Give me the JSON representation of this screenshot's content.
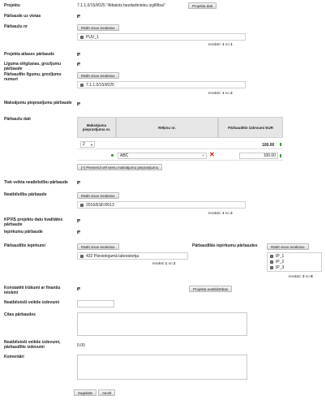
{
  "projekts": {
    "label": "Projekts",
    "value": "7.1.1.0/15/I/025 \"Atbalsts bezdarbnieku izglītībai\"",
    "button": "Projekta dati"
  },
  "parbaude_uz_vietas": {
    "label": "Pārbaude uz vietas"
  },
  "parbauzu_nr": {
    "label": "Pārbaužu nr",
    "button": "Rādīt visus ierakstus",
    "items": [
      "PUV_1"
    ],
    "count_prefix": "Ieraksti:",
    "count_from": "1",
    "count_sep": "no",
    "count_total": "1"
  },
  "projekta_atlases_parbaude": {
    "label": "Projekta atlases pārbaude"
  },
  "liguma_slegsanas": {
    "label": "Līguma slēgšanas, grozījumu pārbaude"
  },
  "parbaudito_ligumu": {
    "label": "Pārbaudīto līgumu, grozījumu numuri",
    "button": "Rādīt visus ierakstus",
    "items": [
      "7.1.1.0/15/I/025"
    ],
    "count_prefix": "Ieraksti:",
    "count_from": "1",
    "count_sep": "no",
    "count_total": "2"
  },
  "maksajumu_pieprasijumu": {
    "label": "Maksājumu pieprasījumu pārbaude"
  },
  "parbauzu_dati": {
    "label": "Pārbaužu dati",
    "col1": "Maksājumu pieprasījuma nr.",
    "col2": "Rēķinu nr.",
    "col3": "Pārbaudītie izdevumi EUR",
    "select_value": "2",
    "total": "100.00",
    "invoice": "ABC",
    "amount": "100.00",
    "add_button": "[+] Pievienot vēl vienu maksājumu pieprasījumu"
  },
  "tiek_veikta": {
    "label": "Tiek veikta neatbilstību pārbaude"
  },
  "neatbilstibu_parbaude": {
    "label": "Neatbilstību pārbaude",
    "button": "Rādīt visus ierakstus",
    "items": [
      "2016/ESF/0013"
    ],
    "count_prefix": "Ieraksti:",
    "count_from": "1",
    "count_sep": "no",
    "count_total": "2"
  },
  "kpvis": {
    "label": "KPVIS projektu datu kvalitātes pārbaude"
  },
  "iepirkumu_parbaude": {
    "label": "Iepirkumu pārbaude"
  },
  "parbauditie_iepirkumi": {
    "label": "Pārbaudītie iepirkumi",
    "button": "Rādīt visus ierakstus",
    "items": [
      "432 Pārvietojamā laboratorija"
    ],
    "count_prefix": "Ieraksti",
    "count_from": "1",
    "count_sep": "no",
    "count_total": "2"
  },
  "parbaudito_iepirkumu_parbaudes": {
    "label": "Pārbaudītās iepirkumu pārbaudes",
    "button": "Rādīt visus ierakstus",
    "items": [
      "IP_1",
      "IP_2",
      "IP_3"
    ],
    "count_prefix": "Ieraksti:",
    "count_from": "3",
    "count_sep": "no",
    "count_total": "8"
  },
  "konstateti": {
    "label": "Konstatēti trūkumi ar finanšu ietekmi",
    "button": "Projekta neatbilstības"
  },
  "neatbilstosi": {
    "label": "Neatbilstoši veiktie izdevumi"
  },
  "citas_parbaudes": {
    "label": "Citas pārbaudes"
  },
  "neatbilstosi_parbauditie": {
    "label": "Neatbilstoši veiktie izdevumi, pārbaudītie izdevumi",
    "value": "0.00"
  },
  "komentari": {
    "label": "Komentāri"
  },
  "footer": {
    "save": "Saglabāt",
    "cancel": "Atcelt"
  }
}
